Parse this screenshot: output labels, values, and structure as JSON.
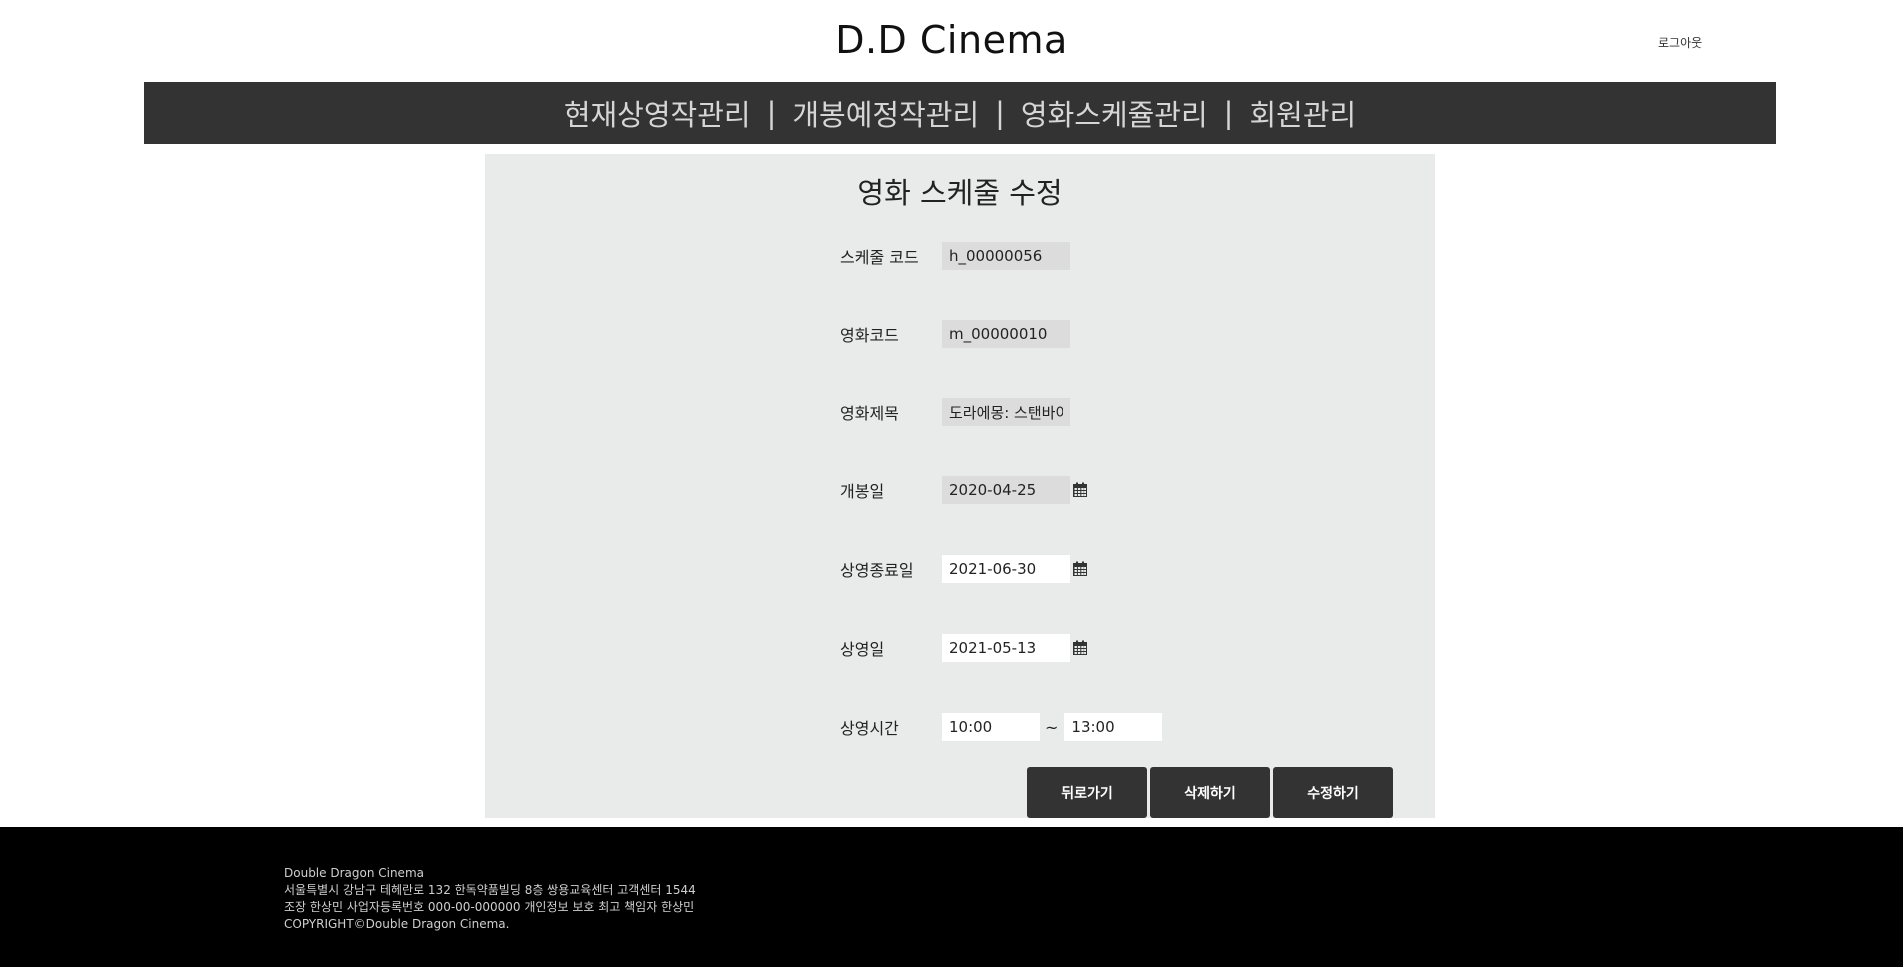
{
  "header": {
    "site_title": "D.D Cinema",
    "logout_label": "로그아웃"
  },
  "nav": {
    "items": [
      {
        "label": "현재상영작관리"
      },
      {
        "label": "개봉예정작관리"
      },
      {
        "label": "영화스케쥴관리"
      },
      {
        "label": "회원관리"
      }
    ],
    "separator": "|"
  },
  "form": {
    "title": "영화 스케줄 수정",
    "fields": {
      "schedule_code": {
        "label": "스케줄 코드",
        "value": "h_00000056"
      },
      "movie_code": {
        "label": "영화코드",
        "value": "m_00000010"
      },
      "movie_title": {
        "label": "영화제목",
        "value": "도라에몽: 스탠바이"
      },
      "release_date": {
        "label": "개봉일",
        "value": "2020-04-25"
      },
      "end_date": {
        "label": "상영종료일",
        "value": "2021-06-30"
      },
      "screening_date": {
        "label": "상영일",
        "value": "2021-05-13"
      },
      "screening_time": {
        "label": "상영시간",
        "start": "10:00",
        "end": "13:00",
        "separator": "~"
      }
    },
    "buttons": {
      "back": "뒤로가기",
      "delete": "삭제하기",
      "update": "수정하기"
    }
  },
  "footer": {
    "lines": [
      "Double Dragon Cinema",
      "서울특별시 강남구 테헤란로 132 한독약품빌딩 8층 쌍용교육센터 고객센터 1544",
      "조장 한상민 사업자등록번호 000-00-000000 개인정보 보호 최고 책임자 한상민",
      "COPYRIGHT©Double Dragon Cinema."
    ]
  },
  "icons": {
    "calendar": "calendar-icon"
  }
}
